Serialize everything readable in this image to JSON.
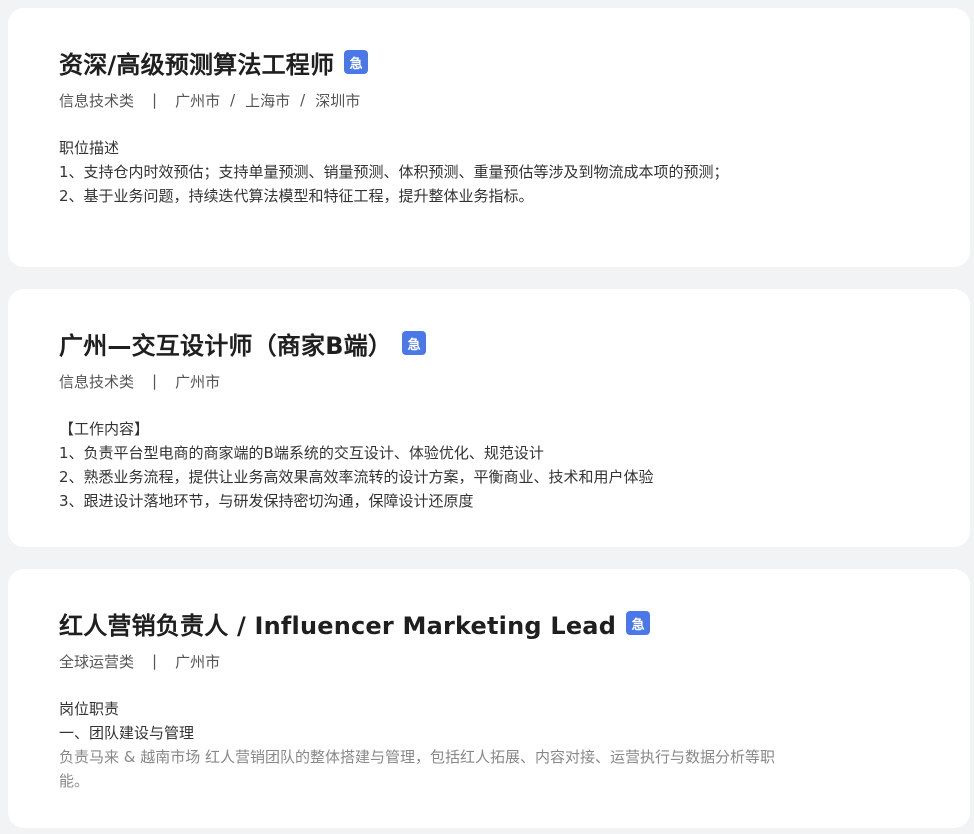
{
  "jobs": [
    {
      "title": "资深/高级预测算法工程师",
      "badge": "急",
      "category": "信息技术类",
      "cities": [
        "广州市",
        "上海市",
        "深圳市"
      ],
      "desc_heading": "职位描述",
      "desc_lines": [
        "1、支持仓内时效预估；支持单量预测、销量预测、体积预测、重量预估等涉及到物流成本项的预测；",
        "2、基于业务问题，持续迭代算法模型和特征工程，提升整体业务指标。"
      ]
    },
    {
      "title": "广州—交互设计师（商家B端）",
      "badge": "急",
      "category": "信息技术类",
      "cities": [
        "广州市"
      ],
      "desc_heading": "【工作内容】",
      "desc_lines": [
        "1、负责平台型电商的商家端的B端系统的交互设计、体验优化、规范设计",
        "2、熟悉业务流程，提供让业务高效果高效率流转的设计方案，平衡商业、技术和用户体验",
        "3、跟进设计落地环节，与研发保持密切沟通，保障设计还原度"
      ]
    },
    {
      "title": "红人营销负责人 / Influencer Marketing Lead",
      "badge": "急",
      "category": "全球运营类",
      "cities": [
        "广州市"
      ],
      "desc_heading": "岗位职责",
      "desc_lines": [
        "一、团队建设与管理"
      ],
      "desc_muted": "负责马来 & 越南市场 红人营销团队的整体搭建与管理，包括红人拓展、内容对接、运营执行与数据分析等职能。"
    }
  ],
  "colors": {
    "background": "#f2f3f5",
    "card": "#ffffff",
    "badge": "#4a78e8"
  }
}
